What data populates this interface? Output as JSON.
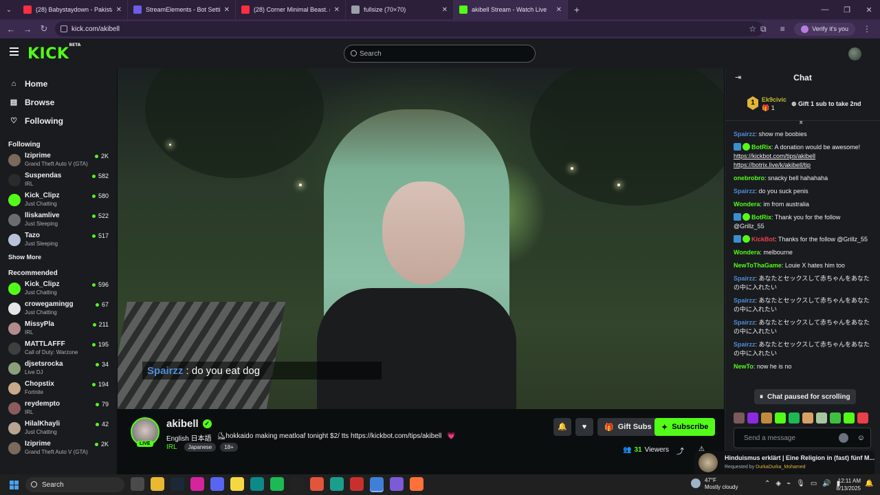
{
  "browser": {
    "tabs": [
      {
        "title": "(28) Babystaydown - Pakistan (I",
        "favicon_color": "#ff2e3e",
        "active": false
      },
      {
        "title": "StreamElements - Bot Settings",
        "favicon_color": "#6d5ce7",
        "active": false
      },
      {
        "title": "(28) Corner Minimal Beast. (Vol",
        "favicon_color": "#ff2e3e",
        "active": false
      },
      {
        "title": "fullsize (70×70)",
        "favicon_color": "#9ba0a8",
        "active": false
      },
      {
        "title": "akibell Stream - Watch Live",
        "favicon_color": "#53fc18",
        "active": true
      }
    ],
    "url": "kick.com/akibell",
    "profile_label": "Verify it's you"
  },
  "header": {
    "logo": "KICK",
    "logo_badge": "BETA",
    "search_placeholder": "Search"
  },
  "sidebar": {
    "nav": [
      {
        "label": "Home",
        "icon": "home-icon",
        "glyph": "⌂"
      },
      {
        "label": "Browse",
        "icon": "browse-icon",
        "glyph": "▤"
      },
      {
        "label": "Following",
        "icon": "heart-icon",
        "glyph": "♡"
      }
    ],
    "following_title": "Following",
    "following": [
      {
        "name": "Iziprime",
        "game": "Grand Theft Auto V (GTA)",
        "viewers": "2K",
        "color": "#7a6a5c"
      },
      {
        "name": "Suspendas",
        "game": "IRL",
        "viewers": "582",
        "color": "#2b2b2b"
      },
      {
        "name": "Kick_Clipz",
        "game": "Just Chatting",
        "viewers": "580",
        "color": "#53fc18"
      },
      {
        "name": "lliskamlive",
        "game": "Just Sleeping",
        "viewers": "522",
        "color": "#6a6d70"
      },
      {
        "name": "Tazo",
        "game": "Just Sleeping",
        "viewers": "517",
        "color": "#b7c3d6"
      }
    ],
    "show_more": "Show More",
    "recommended_title": "Recommended",
    "recommended": [
      {
        "name": "Kick_Clipz",
        "game": "Just Chatting",
        "viewers": "596",
        "color": "#53fc18"
      },
      {
        "name": "crowegamingg",
        "game": "Just Chatting",
        "viewers": "67",
        "color": "#e6e6e6"
      },
      {
        "name": "MissyPla",
        "game": "IRL",
        "viewers": "211",
        "color": "#b28c8c"
      },
      {
        "name": "MATTLAFFF",
        "game": "Call of Duty: Warzone",
        "viewers": "195",
        "color": "#3f3f3f"
      },
      {
        "name": "djsetsrocka",
        "game": "Live DJ",
        "viewers": "34",
        "color": "#8aa07a"
      },
      {
        "name": "Chopstix",
        "game": "Fortnite",
        "viewers": "194",
        "color": "#c9a98a"
      },
      {
        "name": "reydempto",
        "game": "IRL",
        "viewers": "79",
        "color": "#8a5c5c"
      },
      {
        "name": "HilalKhayli",
        "game": "Just Chatting",
        "viewers": "42",
        "color": "#b8a493"
      },
      {
        "name": "Iziprime",
        "game": "Grand Theft Auto V (GTA)",
        "viewers": "2K",
        "color": "#7a6a5c"
      }
    ]
  },
  "video": {
    "overlay_user": "Spairzz",
    "overlay_message": ": do you eat dog"
  },
  "stream": {
    "streamer": "akibell",
    "live_label": "LIVE",
    "title_lang": "English  日本語",
    "title_text": "⛸hokkaido making meatloaf tonight  $2/ tts https://kickbot.com/tips/akibell",
    "title_heart": "💗",
    "category": "IRL",
    "tags": [
      "Japanese",
      "18+"
    ],
    "gift_label": "Gift Subs",
    "subscribe_label": "Subscribe",
    "viewers": "31",
    "viewers_label": "Viewers"
  },
  "chat": {
    "title": "Chat",
    "pinned": {
      "rank": "1",
      "user": "Ek9civic",
      "count": "1",
      "gift_text": "Gift 1 sub to take 2nd"
    },
    "messages": [
      {
        "user": "Spairzz",
        "color": "#4f8bd6",
        "text": "show me boobies"
      },
      {
        "user": "BotRix",
        "color": "#53fc18",
        "badges": true,
        "text": "A donation would be awesome!",
        "links": [
          "https://kickbot.com/tips/akibell",
          "https://botrix.live/k/akibell/tip"
        ]
      },
      {
        "user": "onebrobro",
        "color": "#53fc18",
        "text": "snacky bell hahahaha"
      },
      {
        "user": "Spairzz",
        "color": "#4f8bd6",
        "text": "do you suck penis"
      },
      {
        "user": "Wondera",
        "color": "#53fc18",
        "text": "im from australia"
      },
      {
        "user": "BotRix",
        "color": "#53fc18",
        "badges": true,
        "text": "Thank you for the follow @Grillz_55"
      },
      {
        "user": "KickBot",
        "color": "#e8414a",
        "badges": true,
        "text": "Thanks for the follow @Grillz_55"
      },
      {
        "user": "Wondera",
        "color": "#53fc18",
        "text": "melbourne"
      },
      {
        "user": "NewToThaGame",
        "color": "#53fc18",
        "text": "Louie X hates him too"
      },
      {
        "user": "Spairzz",
        "color": "#4f8bd6",
        "text": "あなたとセックスして赤ちゃんをあなたの中に入れたい"
      },
      {
        "user": "Spairzz",
        "color": "#4f8bd6",
        "text": "あなたとセックスして赤ちゃんをあなたの中に入れたい"
      },
      {
        "user": "Spairzz",
        "color": "#4f8bd6",
        "text": "あなたとセックスして赤ちゃんをあなたの中に入れたい"
      },
      {
        "user": "Spairzz",
        "color": "#4f8bd6",
        "text": "あなたとセックスして赤ちゃんをあなたの中に入れたい"
      },
      {
        "user": "NewTo",
        "color": "#53fc18",
        "text": "now he is no"
      }
    ],
    "paused_label": "Chat paused for scrolling",
    "input_placeholder": "Send a message"
  },
  "promo": {
    "title": "Hinduismus erklärt | Eine Religion in (fast) fünf M...",
    "requested_prefix": "Requested by",
    "requested_by": "DurkaDurka_Mohamed"
  },
  "taskbar": {
    "search_label": "Search",
    "weather_temp": "47°F",
    "weather_desc": "Mostly cloudy",
    "time": "12:11 AM",
    "date": "8/13/2025"
  }
}
